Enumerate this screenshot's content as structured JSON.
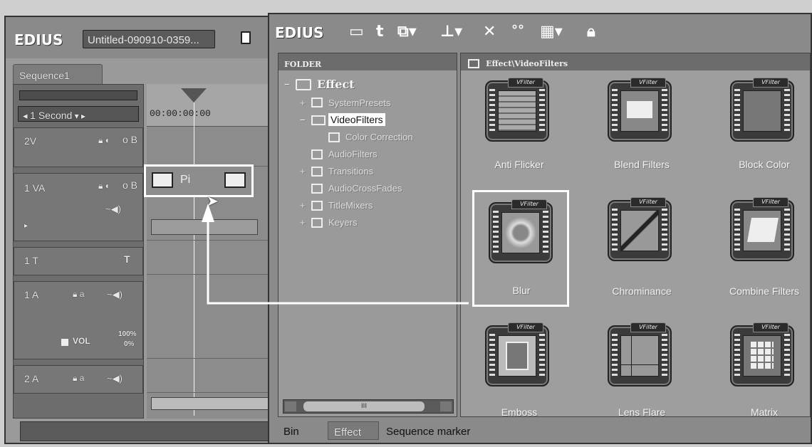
{
  "left_window": {
    "app_name": "EDIUS",
    "project_title": "Untitled-090910-0359...",
    "sequence_tab": "Sequence1",
    "zoom_label": "1 Second",
    "timecode": "00:00:00:00",
    "clip_label": "Pi",
    "tracks": [
      {
        "name": "2V",
        "controls": "o B"
      },
      {
        "name": "1 VA",
        "controls": "o B"
      },
      {
        "name": "1 T",
        "controls": "T"
      },
      {
        "name": "1 A",
        "controls": "a"
      },
      {
        "name": "2 A",
        "controls": "a"
      }
    ],
    "vol_label": "VOL",
    "vol_values": [
      "100%",
      "0%"
    ]
  },
  "right_window": {
    "app_name": "EDIUS",
    "folder_header": "FOLDER",
    "path_header": "Effect\\VideoFilters",
    "tree": [
      {
        "label": "Effect",
        "toggle": "−"
      },
      {
        "label": "SystemPresets",
        "toggle": "+"
      },
      {
        "label": "VideoFilters",
        "toggle": "−"
      },
      {
        "label": "Color Correction",
        "toggle": ""
      },
      {
        "label": "AudioFilters",
        "toggle": ""
      },
      {
        "label": "Transitions",
        "toggle": "+"
      },
      {
        "label": "AudioCrossFades",
        "toggle": ""
      },
      {
        "label": "TitleMixers",
        "toggle": "+"
      },
      {
        "label": "Keyers",
        "toggle": "+"
      }
    ],
    "effects": [
      {
        "label": "Anti Flicker",
        "tag": "VFilter",
        "icon": "anti-flicker-icon"
      },
      {
        "label": "Blend Filters",
        "tag": "VFilter",
        "icon": "blend-filters-icon"
      },
      {
        "label": "Block Color",
        "tag": "VFilter",
        "icon": "block-color-icon"
      },
      {
        "label": "Blur",
        "tag": "VFilter",
        "icon": "blur-icon"
      },
      {
        "label": "Chrominance",
        "tag": "VFilter",
        "icon": "chrominance-icon"
      },
      {
        "label": "Combine Filters",
        "tag": "VFilter",
        "icon": "combine-filters-icon"
      },
      {
        "label": "Emboss",
        "tag": "VFilter",
        "icon": "emboss-icon"
      },
      {
        "label": "Lens Flare",
        "tag": "VFilter",
        "icon": "lens-flare-icon"
      },
      {
        "label": "Matrix",
        "tag": "VFilter",
        "icon": "matrix-icon"
      }
    ],
    "bottom_tabs": [
      "Bin",
      "Effect",
      "Sequence marker"
    ],
    "scroll_indicator": "III"
  },
  "colors": {
    "panel": "#8e8e8e",
    "highlight": "#ffffff",
    "dark": "#3a3a3a"
  }
}
